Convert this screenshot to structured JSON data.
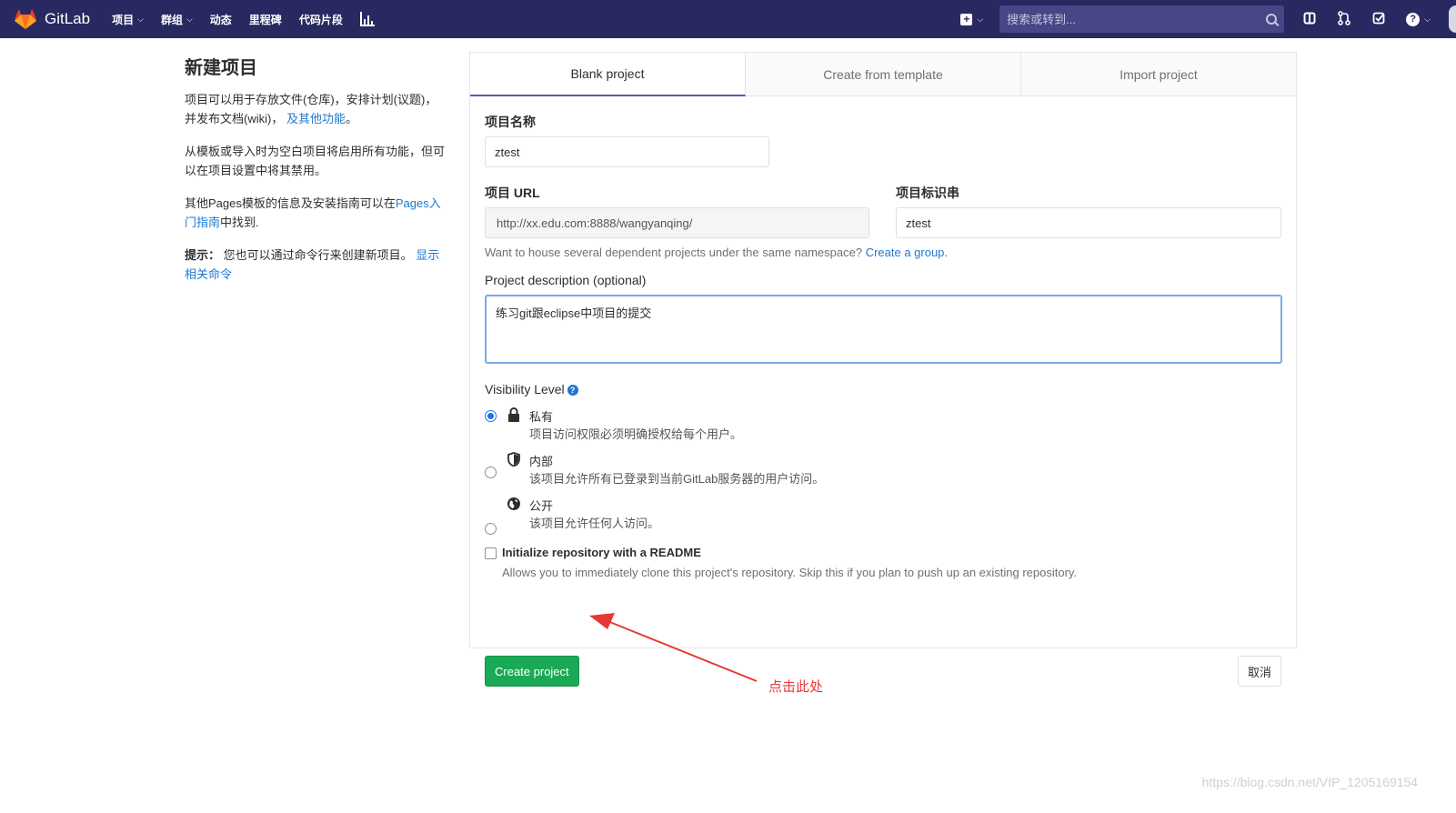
{
  "nav": {
    "brand": "GitLab",
    "links": [
      {
        "label": "项目",
        "caret": true
      },
      {
        "label": "群组",
        "caret": true
      },
      {
        "label": "动态",
        "caret": false
      },
      {
        "label": "里程碑",
        "caret": false
      },
      {
        "label": "代码片段",
        "caret": false
      }
    ],
    "search_placeholder": "搜索或转到...",
    "caret": "⌵",
    "plus": "+",
    "help": "?",
    "icons": [
      "plus-icon",
      "search-icon",
      "sidebar-icon",
      "merge-request-icon",
      "todo-icon",
      "help-icon",
      "chart-icon"
    ]
  },
  "left": {
    "title": "新建项目",
    "p1_text": "项目可以用于存放文件(仓库)，安排计划(议题)，并发布文档(wiki)，",
    "p1_link": "及其他功能",
    "p1_end": "。",
    "p2": "从模板或导入时为空白项目将启用所有功能，但可以在项目设置中将其禁用。",
    "p3_text": "其他Pages模板的信息及安装指南可以在",
    "p3_link": "Pages入门指南",
    "p3_end": "中找到.",
    "p4_strong": "提示：",
    "p4_text": "您也可以通过命令行来创建新项目。",
    "p4_link": "显示相关命令"
  },
  "tabs": [
    "Blank project",
    "Create from template",
    "Import project"
  ],
  "form": {
    "name_label": "项目名称",
    "name_value": "ztest",
    "url_label": "项目 URL",
    "url_value": "http://xx.edu.com:8888/wangyanqing/",
    "slug_label": "项目标识串",
    "slug_value": "ztest",
    "group_help": "Want to house several dependent projects under the same namespace?",
    "group_link": "Create a group.",
    "desc_label": "Project description (optional)",
    "desc_value": "练习git跟eclipse中项目的提交",
    "visibility_label": "Visibility Level",
    "visibility_options": [
      {
        "label": "私有",
        "desc": "项目访问权限必须明确授权给每个用户。",
        "icon": "lock-icon",
        "checked": true
      },
      {
        "label": "内部",
        "desc": "该项目允许所有已登录到当前GitLab服务器的用户访问。",
        "icon": "shield-icon",
        "checked": false
      },
      {
        "label": "公开",
        "desc": "该项目允许任何人访问。",
        "icon": "globe-icon",
        "checked": false
      }
    ],
    "readme_label": "Initialize repository with a README",
    "readme_desc": "Allows you to immediately clone this project's repository. Skip this if you plan to push up an existing repository.",
    "create_button": "Create project",
    "cancel_button": "取消"
  },
  "annotation": "点击此处",
  "watermark": "https://blog.csdn.net/VIP_1205169154",
  "colors": {
    "nav_bg": "#292961",
    "accent": "#1aaa55",
    "link": "#1f78d1",
    "tab_active": "#6b4fbb",
    "annotation": "#e53935"
  }
}
